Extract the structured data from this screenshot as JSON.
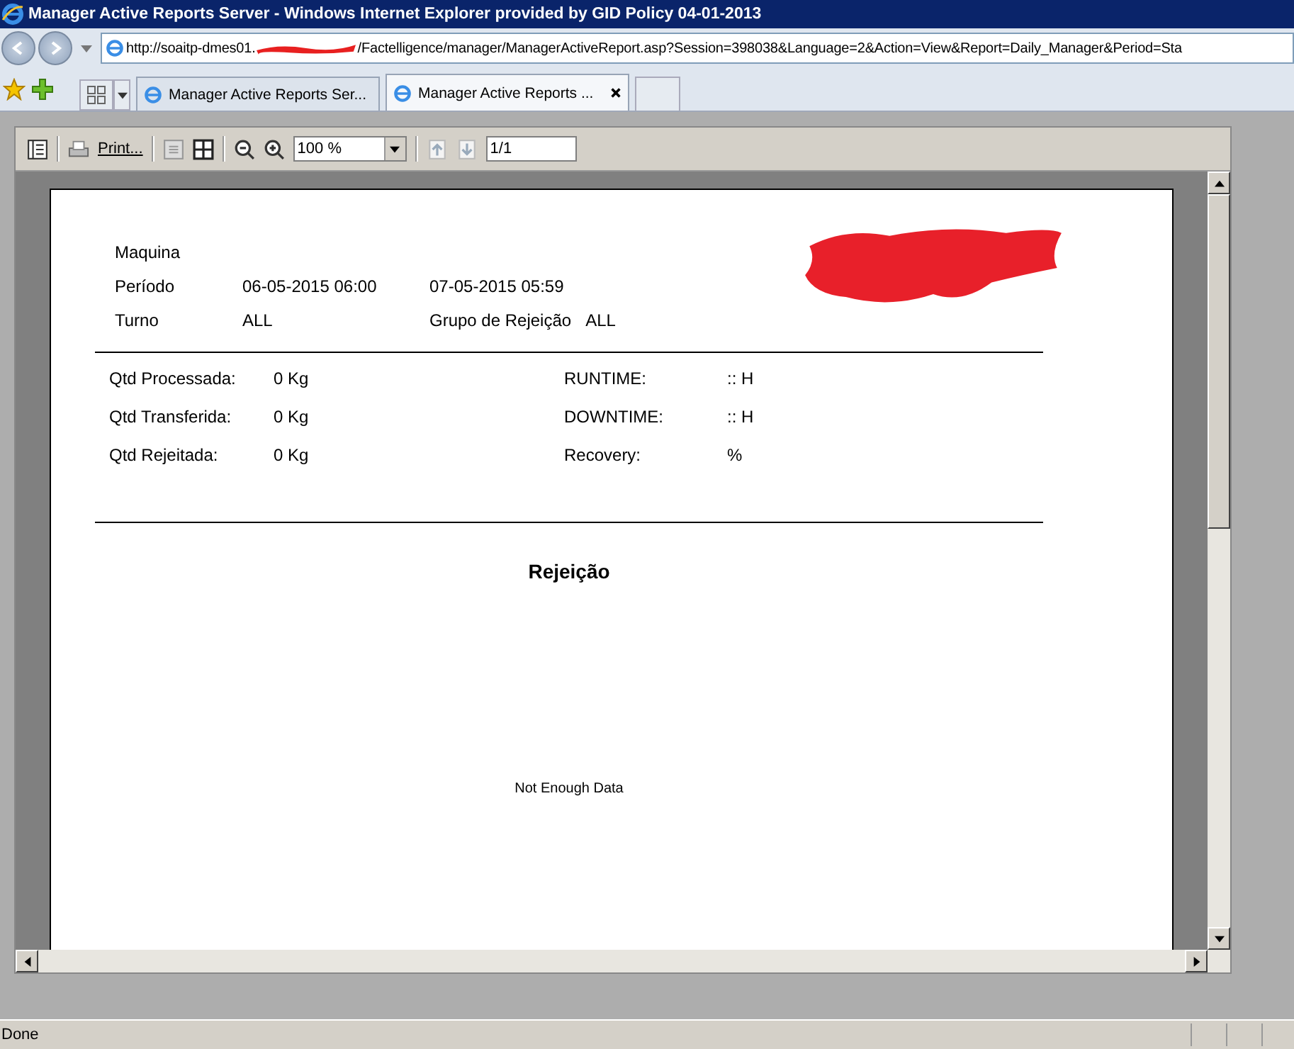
{
  "window": {
    "title": "Manager Active Reports Server - Windows Internet Explorer provided by GID Policy 04-01-2013"
  },
  "address": {
    "url_start": "http://soaitp-dmes01.",
    "url_end": "/Factelligence/manager/ManagerActiveReport.asp?Session=398038&Language=2&Action=View&Report=Daily_Manager&Period=Sta"
  },
  "tabs": [
    {
      "label": "Manager Active Reports Ser...",
      "selected": false
    },
    {
      "label": "Manager Active Reports ...",
      "selected": true
    }
  ],
  "toolbar": {
    "print_label": "Print...",
    "zoom": "100 %",
    "page": "1/1"
  },
  "report": {
    "header": [
      {
        "label": "Maquina"
      },
      {
        "label": "Período",
        "value": "06-05-2015 06:00",
        "extra_label": "07-05-2015 05:59"
      },
      {
        "label": "Turno",
        "value": "ALL",
        "extra_label": "Grupo de Rejeição",
        "extra_value": "ALL"
      }
    ],
    "stats": [
      {
        "label": "Qtd Processada:",
        "value": "0 Kg",
        "label2": "RUNTIME:",
        "value2": ":: H"
      },
      {
        "label": "Qtd Transferida:",
        "value": "0 Kg",
        "label2": "DOWNTIME:",
        "value2": ":: H"
      },
      {
        "label": "Qtd Rejeitada:",
        "value": "0 Kg",
        "label2": "Recovery:",
        "value2": "%"
      }
    ],
    "section_title": "Rejeição",
    "empty_message": "Not Enough Data"
  },
  "status_bar": {
    "text": "Done"
  }
}
